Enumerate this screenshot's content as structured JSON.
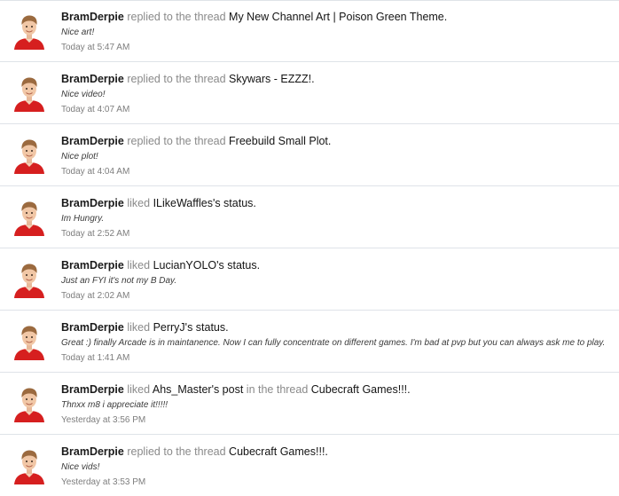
{
  "feed": {
    "items": [
      {
        "avatar_icon": "user-avatar-icon",
        "user": "BramDerpie",
        "verb": "replied to the thread",
        "target": "My New Channel Art | Poison Green Theme",
        "suffix": ".",
        "snippet": "Nice art!",
        "time": "Today at 5:47 AM"
      },
      {
        "avatar_icon": "user-avatar-icon",
        "user": "BramDerpie",
        "verb": "replied to the thread",
        "target": "Skywars - EZZZ!",
        "suffix": ".",
        "snippet": "Nice video!",
        "time": "Today at 4:07 AM"
      },
      {
        "avatar_icon": "user-avatar-icon",
        "user": "BramDerpie",
        "verb": "replied to the thread",
        "target": "Freebuild Small Plot",
        "suffix": ".",
        "snippet": "Nice plot!",
        "time": "Today at 4:04 AM"
      },
      {
        "avatar_icon": "user-avatar-icon",
        "user": "BramDerpie",
        "verb": "liked",
        "target": "ILikeWaffles's status",
        "suffix": ".",
        "snippet": "Im Hungry.",
        "time": "Today at 2:52 AM"
      },
      {
        "avatar_icon": "user-avatar-icon",
        "user": "BramDerpie",
        "verb": "liked",
        "target": "LucianYOLO's status",
        "suffix": ".",
        "snippet": "Just an FYI it's not my B Day.",
        "time": "Today at 2:02 AM"
      },
      {
        "avatar_icon": "user-avatar-icon",
        "user": "BramDerpie",
        "verb": "liked",
        "target": "PerryJ's status",
        "suffix": ".",
        "snippet": "Great :) finally Arcade is in maintanence. Now I can fully concentrate on different games. I'm bad at pvp but you can always ask me to play.",
        "time": "Today at 1:41 AM"
      },
      {
        "avatar_icon": "user-avatar-icon",
        "user": "BramDerpie",
        "verb": "liked",
        "target": "Ahs_Master's post",
        "verb2": "in the thread",
        "target2": "Cubecraft Games!!!",
        "suffix": ".",
        "snippet": "Thnxx m8 i appreciate it!!!!!",
        "time": "Yesterday at 3:56 PM"
      },
      {
        "avatar_icon": "user-avatar-icon",
        "user": "BramDerpie",
        "verb": "replied to the thread",
        "target": "Cubecraft Games!!!",
        "suffix": ".",
        "snippet": "Nice vids!",
        "time": "Yesterday at 3:53 PM"
      }
    ]
  },
  "colors": {
    "divider": "#dfe3e8",
    "username": "#1a1a1a",
    "verb": "#8a8a8a",
    "link": "#141414",
    "time": "#7d7d7d",
    "avatar_shirt": "#d61f1f"
  }
}
